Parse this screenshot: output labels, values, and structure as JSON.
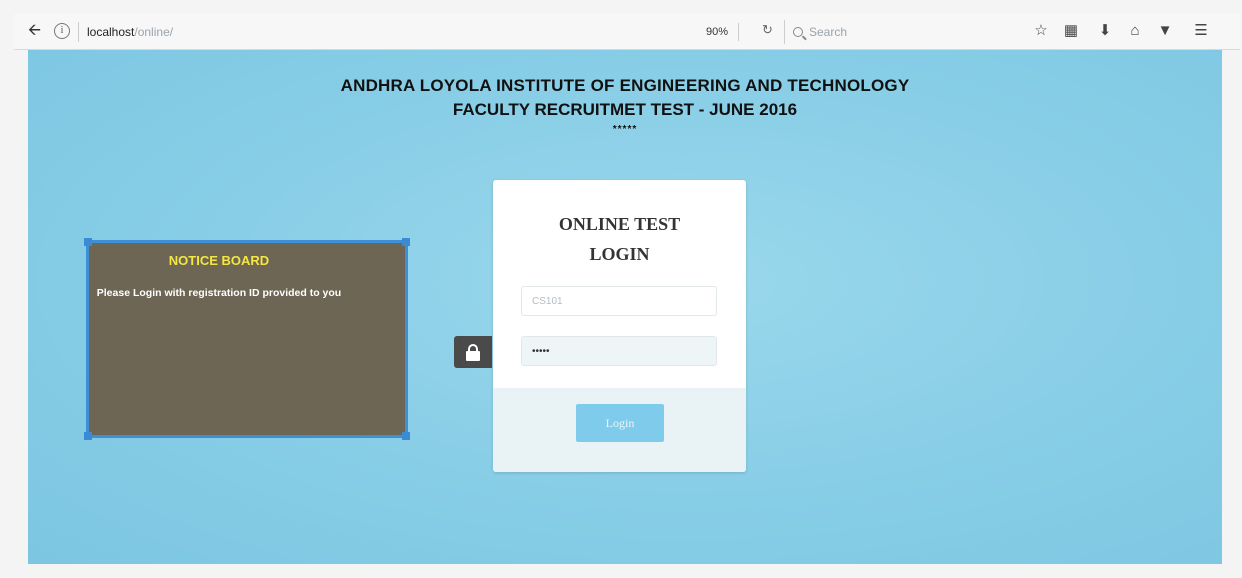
{
  "browser": {
    "url_host": "localhost",
    "url_path": "/online/",
    "zoom": "90%",
    "search_placeholder": "Search"
  },
  "header": {
    "line1": "ANDHRA LOYOLA INSTITUTE OF ENGINEERING AND TECHNOLOGY",
    "line2": "FACULTY RECRUITMET TEST - JUNE 2016",
    "line3": "*****"
  },
  "notice_board": {
    "title": "NOTICE BOARD",
    "message": "Please Login with registration ID provided to you"
  },
  "login": {
    "title_line1": "ONLINE TEST",
    "title_line2": "LOGIN",
    "username_value": "CS101",
    "password_value": "•••••",
    "button_label": "Login"
  },
  "colors": {
    "page_background": "#87cde6",
    "notice_background": "#6d6655",
    "notice_title": "#f5e642",
    "login_button": "#7fcbec"
  }
}
